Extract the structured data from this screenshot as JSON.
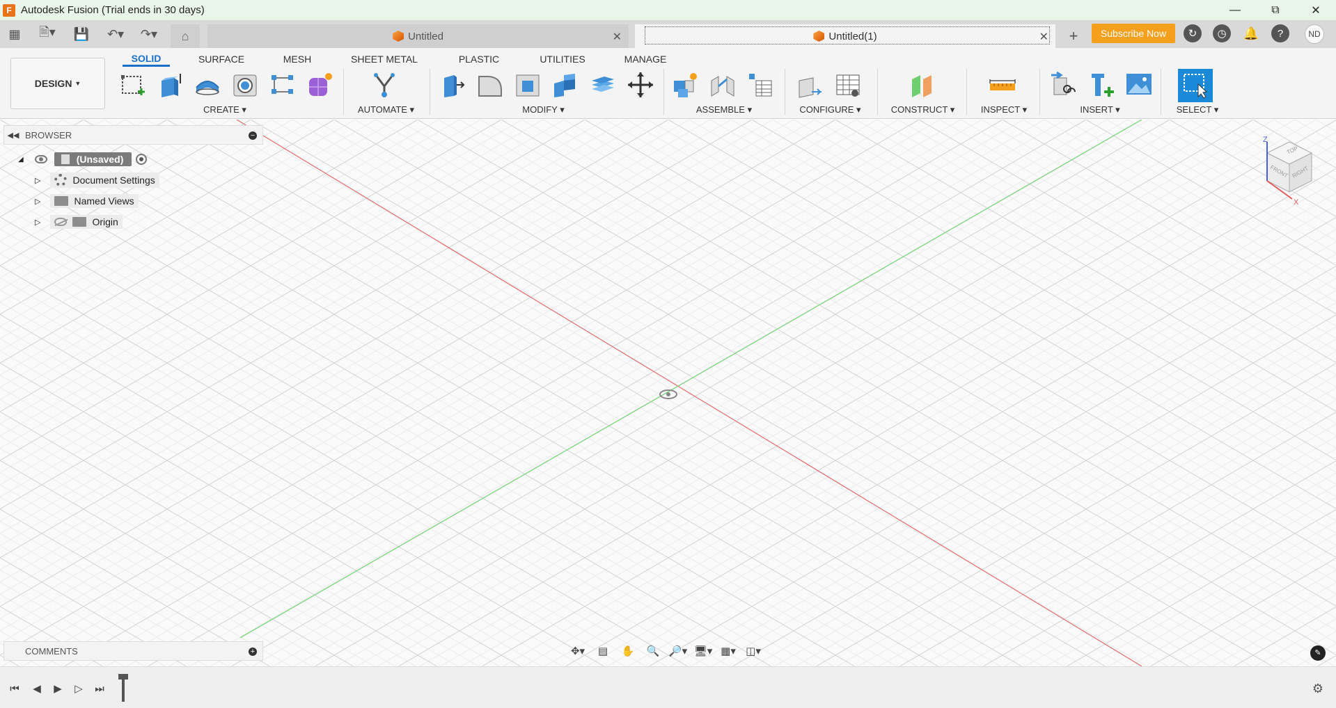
{
  "window": {
    "title": "Autodesk Fusion (Trial ends in 30 days)",
    "logo_letter": "F"
  },
  "appbar": {
    "tabs": [
      {
        "label": "Untitled",
        "active": false
      },
      {
        "label": "Untitled(1)",
        "active": true
      }
    ],
    "subscribe_label": "Subscribe Now",
    "avatar_initials": "ND"
  },
  "ribbon": {
    "workspace": "DESIGN",
    "tabs": [
      "SOLID",
      "SURFACE",
      "MESH",
      "SHEET METAL",
      "PLASTIC",
      "UTILITIES",
      "MANAGE"
    ],
    "groups": [
      "CREATE",
      "AUTOMATE",
      "MODIFY",
      "ASSEMBLE",
      "CONFIGURE",
      "CONSTRUCT",
      "INSPECT",
      "INSERT",
      "SELECT"
    ]
  },
  "browser": {
    "title": "BROWSER",
    "root": "(Unsaved)",
    "items": [
      "Document Settings",
      "Named Views",
      "Origin"
    ]
  },
  "comments": {
    "title": "COMMENTS"
  },
  "viewcube": {
    "top": "TOP",
    "front": "FRONT",
    "right": "RIGHT",
    "z": "Z",
    "x": "X"
  },
  "colors": {
    "accent": "#1a6fc9",
    "subscribe": "#f4a01c",
    "x_axis": "#e26a6a",
    "y_axis": "#6fd16f"
  }
}
